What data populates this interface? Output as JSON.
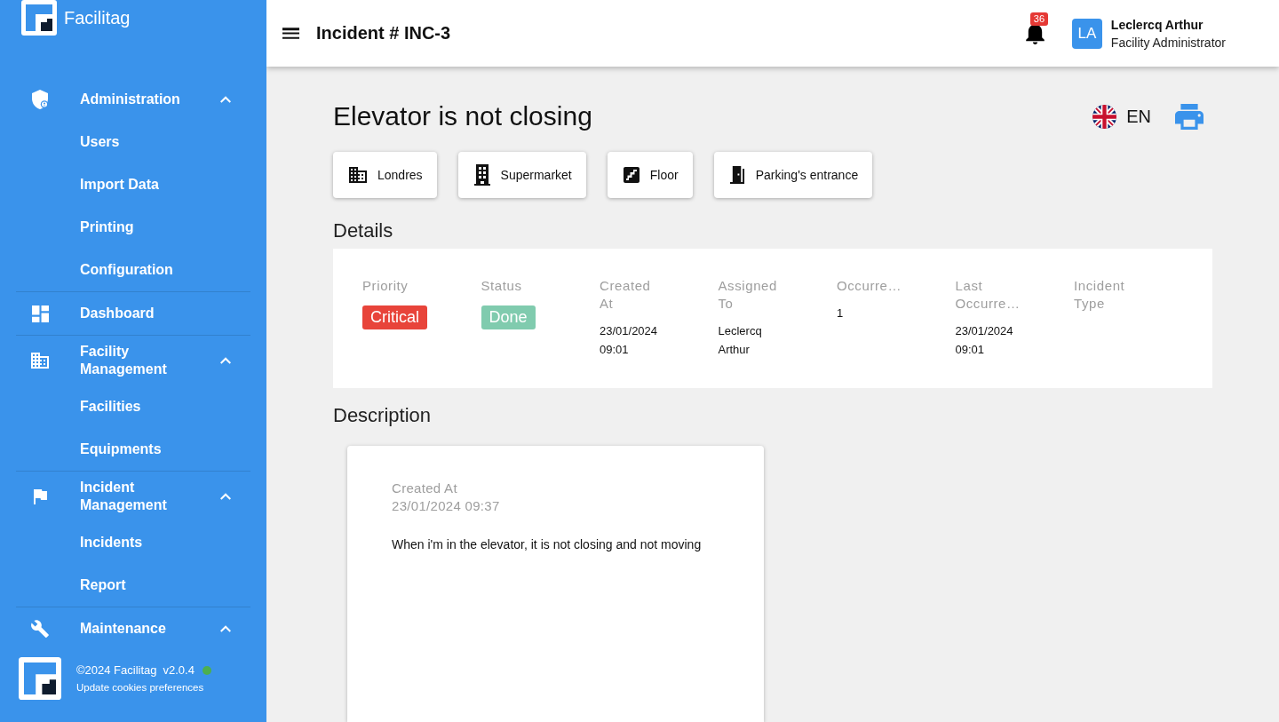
{
  "sidebar": {
    "brand": "Facilitag",
    "items": [
      {
        "kind": "group",
        "label": "Administration",
        "expanded": true,
        "children": [
          {
            "label": "Users"
          },
          {
            "label": "Import Data"
          },
          {
            "label": "Printing"
          },
          {
            "label": "Configuration"
          }
        ]
      },
      {
        "kind": "link",
        "label": "Dashboard"
      },
      {
        "kind": "group",
        "label": "Facility Management",
        "expanded": true,
        "children": [
          {
            "label": "Facilities"
          },
          {
            "label": "Equipments"
          }
        ]
      },
      {
        "kind": "group",
        "label": "Incident Management",
        "expanded": true,
        "children": [
          {
            "label": "Incidents"
          },
          {
            "label": "Report"
          }
        ]
      },
      {
        "kind": "group",
        "label": "Maintenance",
        "expanded": true
      }
    ],
    "footer": {
      "copyright": "©2024 Facilitag",
      "version": "v2.0.4",
      "online": true,
      "cookies_link": "Update cookies preferences"
    }
  },
  "header": {
    "title": "Incident # INC-3",
    "notifications": {
      "count": "36"
    },
    "user": {
      "initials": "LA",
      "name": "Leclercq Arthur",
      "role": "Facility Administrator"
    }
  },
  "incident": {
    "title": "Elevator is not closing",
    "language": "EN",
    "locations": [
      {
        "label": "Londres"
      },
      {
        "label": "Supermarket"
      },
      {
        "label": "Floor"
      },
      {
        "label": "Parking's entrance"
      }
    ],
    "details": {
      "heading": "Details",
      "fields": [
        {
          "label": "Priority",
          "kind": "badge",
          "value": "Critical",
          "color": "#e8443a"
        },
        {
          "label": "Status",
          "kind": "badge",
          "value": "Done",
          "color": "#80cbae"
        },
        {
          "label": "Created At",
          "kind": "text",
          "value": "23/01/2024 09:01"
        },
        {
          "label": "Assigned To",
          "kind": "text",
          "value": "Leclercq Arthur"
        },
        {
          "label": "Occurre…",
          "kind": "text",
          "value": "1"
        },
        {
          "label": "Last Occurre…",
          "kind": "text",
          "value": "23/01/2024 09:01"
        },
        {
          "label": "Incident Type",
          "kind": "text"
        }
      ]
    },
    "description": {
      "heading": "Description",
      "created_label": "Created At",
      "created_at": "23/01/2024 09:37",
      "text": "When i'm in the elevator, it is not closing and not moving"
    }
  }
}
